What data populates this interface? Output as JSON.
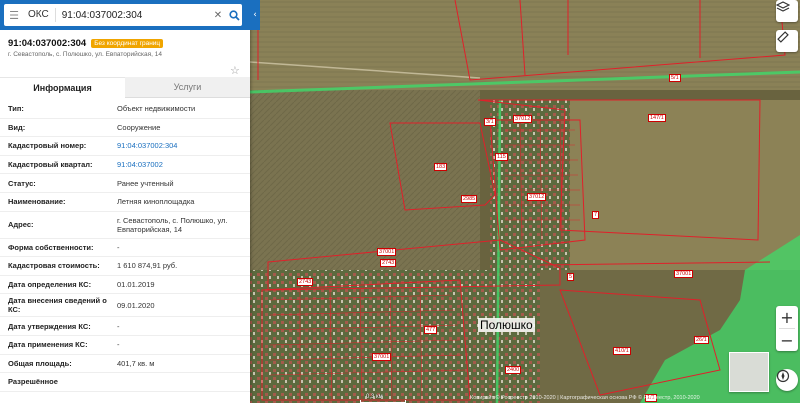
{
  "search": {
    "type_label": "ОКС",
    "query": "91:04:037002:304"
  },
  "object": {
    "number": "91:04:037002:304",
    "badge": "Без координат границ",
    "address_short": "г. Севастополь, с. Полюшко, ул. Евпаторийская, 14"
  },
  "tabs": [
    {
      "label": "Информация",
      "active": true
    },
    {
      "label": "Услуги",
      "active": false
    }
  ],
  "properties": [
    {
      "label": "Тип:",
      "value": "Объект недвижимости"
    },
    {
      "label": "Вид:",
      "value": "Сооружение"
    },
    {
      "label": "Кадастровый номер:",
      "value": "91:04:037002:304",
      "link": true
    },
    {
      "label": "Кадастровый квартал:",
      "value": "91:04:037002",
      "link": true
    },
    {
      "label": "Статус:",
      "value": "Ранее учтенный"
    },
    {
      "label": "Наименование:",
      "value": "Летняя киноплощадка"
    },
    {
      "label": "Адрес:",
      "value": "г. Севастополь, с. Полюшко, ул. Евпаторийская, 14"
    },
    {
      "label": "Форма собственности:",
      "value": "-"
    },
    {
      "label": "Кадастровая стоимость:",
      "value": "1 610 874,91 руб."
    },
    {
      "label": "Дата определения КС:",
      "value": "01.01.2019"
    },
    {
      "label": "Дата внесения сведений о КС:",
      "value": "09.01.2020"
    },
    {
      "label": "Дата утверждения КС:",
      "value": "-"
    },
    {
      "label": "Дата применения КС:",
      "value": "-"
    },
    {
      "label": "Общая площадь:",
      "value": "401,7 кв. м"
    },
    {
      "label": "Разрешённое",
      "value": ""
    }
  ],
  "map": {
    "place_name": "Полюшко",
    "scale_label": "0,3 км",
    "copyright": "Копирайт © Росреестр 2010-2020 | Картографическая основа РФ © Росреестр, 2010-2020",
    "parcel_labels": [
      {
        "text": "5/1"
      },
      {
        "text": "147/1"
      },
      {
        "text": "3/1"
      },
      {
        "text": "37012"
      },
      {
        "text": "183"
      },
      {
        "text": "115"
      },
      {
        "text": "2985"
      },
      {
        "text": "37012"
      },
      {
        "text": "7"
      },
      {
        "text": "37001"
      },
      {
        "text": "2743"
      },
      {
        "text": "2743"
      },
      {
        "text": "37001"
      },
      {
        "text": "37001"
      },
      {
        "text": "410/1"
      },
      {
        "text": "2400"
      },
      {
        "text": "477"
      },
      {
        "text": "5"
      },
      {
        "text": "26/1"
      },
      {
        "text": "1/1"
      }
    ]
  },
  "icons": {
    "menu": "menu-icon",
    "clear": "clear-icon",
    "search": "search-icon",
    "layers": "layers-icon",
    "ruler": "ruler-icon",
    "star": "star-icon",
    "compass": "compass-icon"
  },
  "colors": {
    "accent": "#1a6fbf",
    "badge": "#f0a500",
    "parcel_border": "#e0202a",
    "zone_green": "#3fd96a"
  }
}
